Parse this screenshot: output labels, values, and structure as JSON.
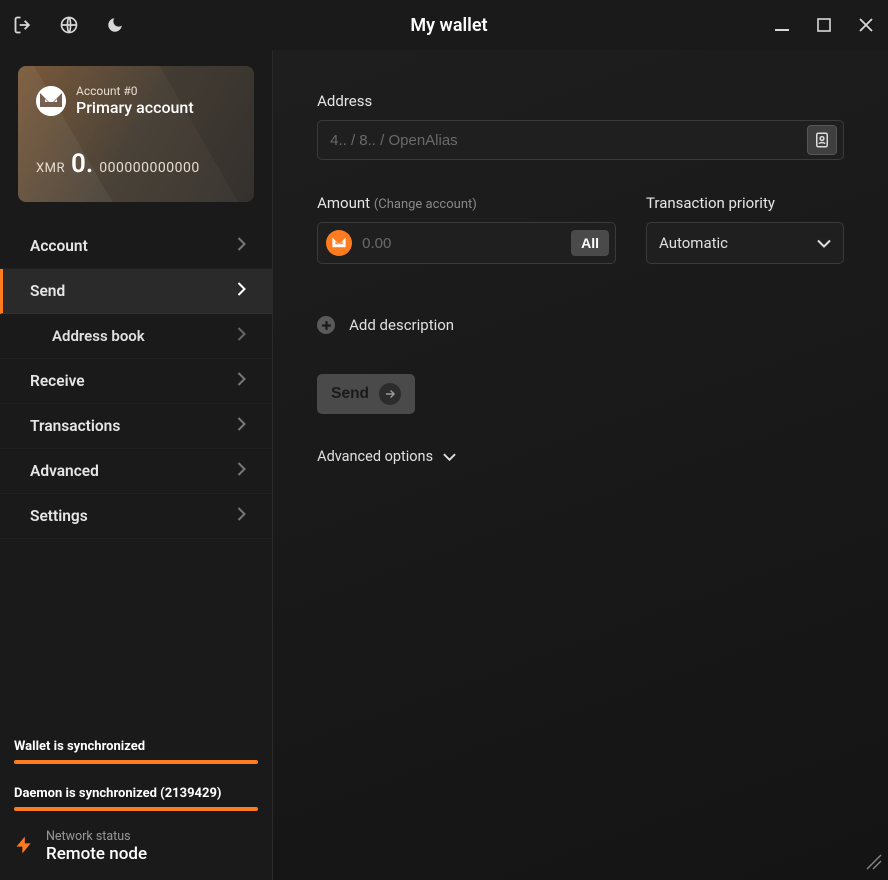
{
  "titlebar": {
    "title": "My wallet"
  },
  "account_card": {
    "account_number": "Account #0",
    "account_name": "Primary account",
    "currency": "XMR",
    "balance_whole": "0.",
    "balance_fraction": "000000000000"
  },
  "nav": {
    "account": "Account",
    "send": "Send",
    "address_book": "Address book",
    "receive": "Receive",
    "transactions": "Transactions",
    "advanced": "Advanced",
    "settings": "Settings"
  },
  "status": {
    "wallet_sync": "Wallet is synchronized",
    "daemon_sync": "Daemon is synchronized (2139429)",
    "network_label": "Network status",
    "network_value": "Remote node"
  },
  "form": {
    "address_label": "Address",
    "address_placeholder": "4.. / 8.. / OpenAlias",
    "amount_label": "Amount",
    "amount_hint": "(Change account)",
    "amount_placeholder": "0.00",
    "all_button": "All",
    "priority_label": "Transaction priority",
    "priority_value": "Automatic",
    "add_description": "Add description",
    "send_button": "Send",
    "advanced_options": "Advanced options"
  }
}
